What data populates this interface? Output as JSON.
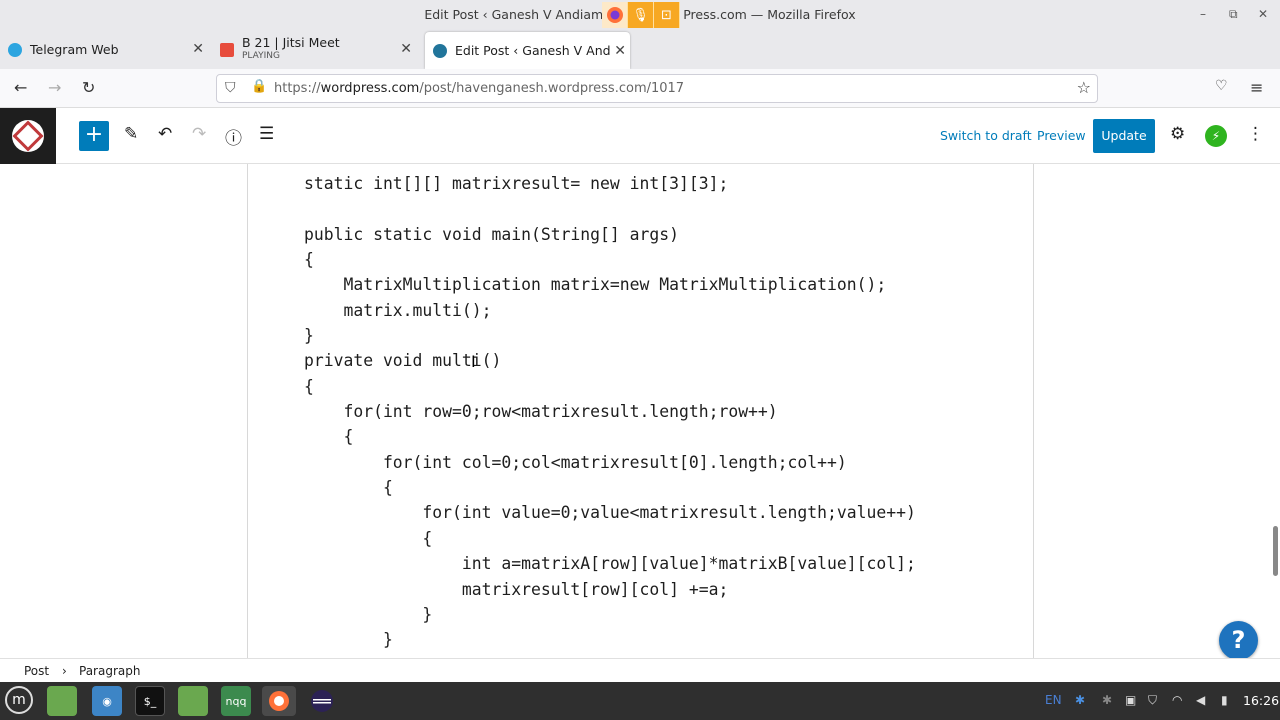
{
  "window": {
    "title": "Edit Post ‹ Ganesh V Andiam",
    "title_suffix": "Press.com — Mozilla Firefox",
    "minimize": "–",
    "maximize": "⧉",
    "close": "✕"
  },
  "tabs": [
    {
      "label": "Telegram Web",
      "favicon_color": "#2ca5e0"
    },
    {
      "label": "B 21 | Jitsi Meet",
      "sub": "PLAYING",
      "favicon_color": "#e74c3c"
    },
    {
      "label": "Edit Post ‹ Ganesh V Andiam",
      "favicon_color": "#21759b",
      "active": true
    }
  ],
  "new_tab": "+",
  "nav": {
    "url_prefix": "https://",
    "url_domain": "wordpress.com",
    "url_path": "/post/havenganesh.wordpress.com/1017"
  },
  "wp_toolbar": {
    "add": "+",
    "switch_to_draft": "Switch to draft",
    "preview": "Preview",
    "update": "Update"
  },
  "code_lines": [
    "static int[][] matrixresult= new int[3][3];",
    "",
    "public static void main(String[] args)",
    "{",
    "    MatrixMultiplication matrix=new MatrixMultiplication();",
    "    matrix.multi();",
    "}",
    "private void multi()",
    "{",
    "    for(int row=0;row<matrixresult.length;row++)",
    "    {",
    "        for(int col=0;col<matrixresult[0].length;col++)",
    "        {",
    "            for(int value=0;value<matrixresult.length;value++)",
    "            {",
    "                int a=matrixA[row][value]*matrixB[value][col];",
    "                matrixresult[row][col] +=a;",
    "            }",
    "        }"
  ],
  "help": "?",
  "breadcrumb": {
    "post": "Post",
    "separator": "›",
    "paragraph": "Paragraph"
  },
  "taskbar": {
    "lang": "EN",
    "time": "16:26"
  }
}
